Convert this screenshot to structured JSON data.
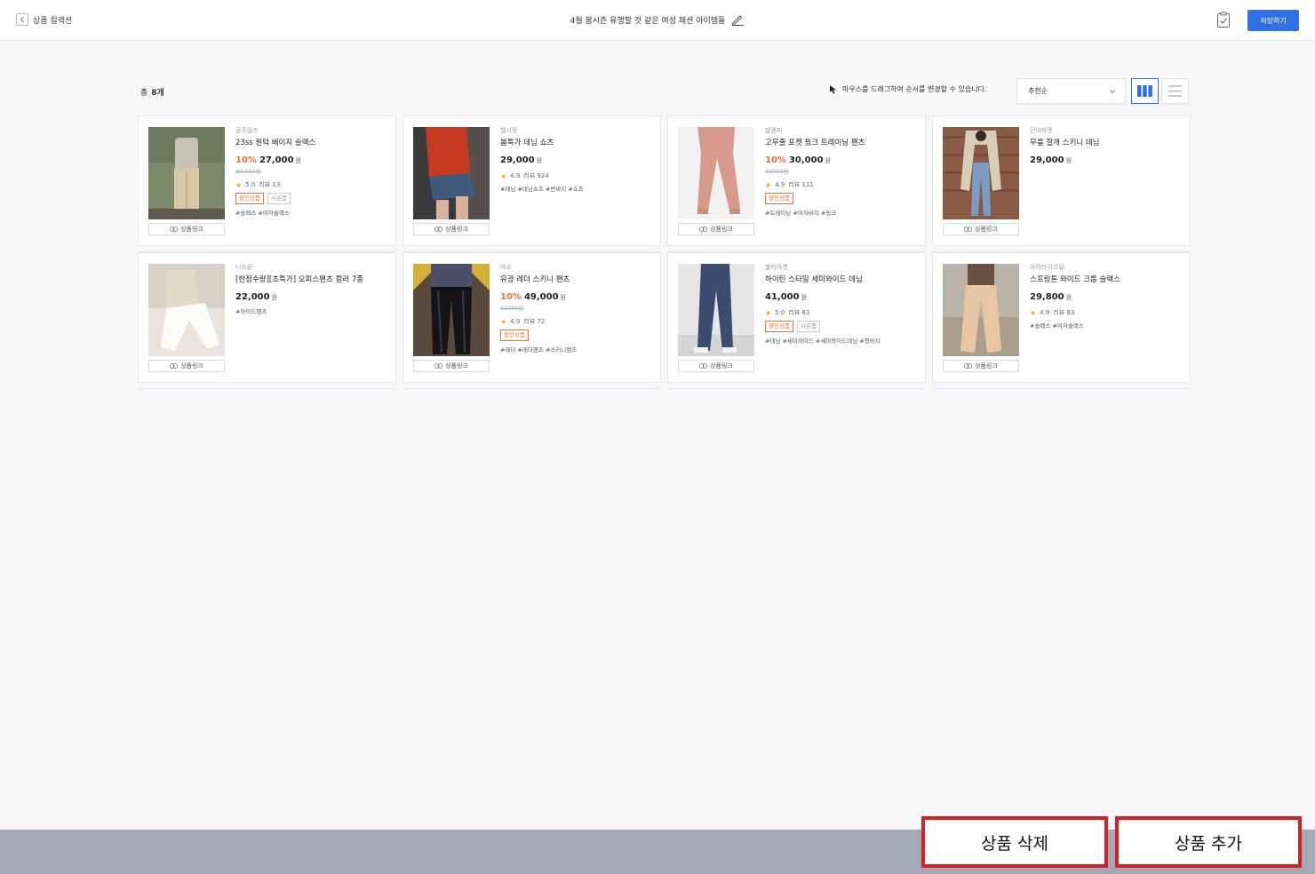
{
  "header": {
    "back_label": "상품 컬렉션",
    "collection_title": "4월 봄시즌 유행할 것 같은 여성 패션 아이템들",
    "save_label": "저장하기"
  },
  "toolbar": {
    "total_label": "총",
    "total_count": "8개",
    "drag_hint": "마우스를 드래그하여 순서를 변경할 수 있습니다.",
    "sort_selected": "추천순"
  },
  "products": [
    {
      "brand": "공주걸즈",
      "name": "23ss 원턱 베이지 슬랙스",
      "discount": "10%",
      "price": "27,000",
      "currency": "원",
      "original_price": "30,000원",
      "rating": "5.0",
      "reviews": "리뷰 13",
      "badges": [
        "할인상품",
        "사은품"
      ],
      "tags": "#슬랙스 #여자슬랙스",
      "link_label": "상품링크"
    },
    {
      "brand": "헬시핏",
      "name": "봄특가 데님 쇼츠",
      "discount": "",
      "price": "29,000",
      "currency": "원",
      "original_price": "",
      "rating": "4.9",
      "reviews": "리뷰 924",
      "badges": [],
      "tags": "#데님 #데님쇼츠 #반바지 #쇼츠",
      "link_label": "상품링크"
    },
    {
      "brand": "발렌띠",
      "name": "고무줄 포켓 핑크 트레이닝 팬츠",
      "discount": "10%",
      "price": "30,000",
      "currency": "원",
      "original_price": "33000원",
      "rating": "4.9",
      "reviews": "리뷰 111",
      "badges": [
        "할인상품"
      ],
      "tags": "#트레이닝 #여자바지 #핑크",
      "link_label": "상품링크"
    },
    {
      "brand": "단아하켓",
      "name": "무릎 절개 스키니 데님",
      "discount": "",
      "price": "29,000",
      "currency": "원",
      "original_price": "",
      "rating": "",
      "reviews": "",
      "badges": [],
      "tags": "",
      "link_label": "상품링크"
    },
    {
      "brand": "니드원",
      "name": "[한정수량][초특가] 오피스팬츠 컬러 7종",
      "discount": "",
      "price": "22,000",
      "currency": "원",
      "original_price": "",
      "rating": "",
      "reviews": "",
      "badges": [],
      "tags": "#와이드팬츠",
      "link_label": "상품링크"
    },
    {
      "brand": "마소",
      "name": "유광 레더 스키니 팬츠",
      "discount": "10%",
      "price": "49,000",
      "currency": "원",
      "original_price": "52000원",
      "rating": "4.9",
      "reviews": "리뷰 72",
      "badges": [
        "할인상품"
      ],
      "tags": "#레더 #레더팬츠 #스키니팬츠",
      "link_label": "상품링크"
    },
    {
      "brand": "블리마켓",
      "name": "하이틴 스타일 세미와이드 데님",
      "discount": "",
      "price": "41,000",
      "currency": "원",
      "original_price": "",
      "rating": "5.0",
      "reviews": "리뷰 83",
      "badges": [
        "할인상품",
        "사은품"
      ],
      "tags": "#데님 #세미와이드 #세미와이드데님 #청바지",
      "link_label": "상품링크"
    },
    {
      "brand": "아이라이크유",
      "name": "스프링톤 와이드 크롭 슬랙스",
      "discount": "",
      "price": "29,800",
      "currency": "원",
      "original_price": "",
      "rating": "4.9",
      "reviews": "리뷰 83",
      "badges": [],
      "tags": "#슬랙스 #여자슬랙스",
      "link_label": "상품링크"
    }
  ],
  "footer": {
    "delete_label": "상품 삭제",
    "add_label": "상품 추가"
  },
  "colors": {
    "accent": "#2f6fe8",
    "discount": "#f0712c",
    "footer_bg": "#a4a9b7",
    "highlight_border": "#d62020"
  }
}
